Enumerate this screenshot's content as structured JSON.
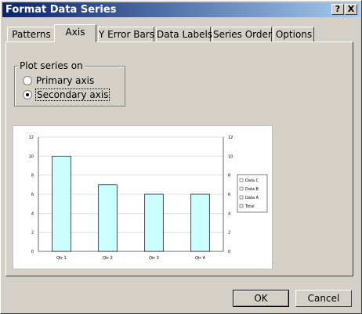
{
  "window": {
    "title": "Format Data Series",
    "help_label": "?",
    "close_label": "X"
  },
  "tabs": [
    {
      "label": "Patterns"
    },
    {
      "label": "Axis"
    },
    {
      "label": "Y Error Bars"
    },
    {
      "label": "Data Labels"
    },
    {
      "label": "Series Order"
    },
    {
      "label": "Options"
    }
  ],
  "active_tab": "Axis",
  "plot_series": {
    "group_label": "Plot series on",
    "options": [
      {
        "label": "Primary axis",
        "selected": false
      },
      {
        "label": "Secondary axis",
        "selected": true
      }
    ]
  },
  "chart_data": {
    "type": "bar",
    "categories": [
      "Qtr 1",
      "Qtr 2",
      "Qtr 3",
      "Qtr 4"
    ],
    "series": [
      {
        "name": "Total",
        "values": [
          10,
          7,
          6,
          6
        ]
      }
    ],
    "ylim": [
      0,
      12
    ],
    "y_ticks": [
      "0",
      "2",
      "4",
      "6",
      "8",
      "10",
      "12"
    ],
    "secondary_y_ticks": [
      "0",
      "2",
      "4",
      "6",
      "8",
      "10",
      "12"
    ],
    "legend": [
      "Data C",
      "Data B",
      "Data A",
      "Total"
    ],
    "legend_position": "right",
    "grid": true,
    "bar_color": "#ccffff"
  },
  "buttons": {
    "ok_label": "OK",
    "cancel_label": "Cancel"
  }
}
